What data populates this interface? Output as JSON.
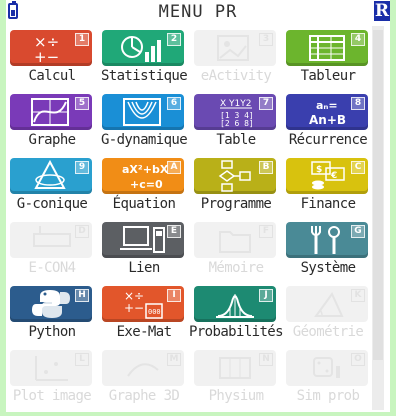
{
  "header": {
    "title": "MENU PR",
    "mode_badge": "R",
    "battery_icon": "battery-icon"
  },
  "colors": {
    "calcul": "#d94a2f",
    "statistique": "#20a878",
    "tableur": "#6cb52d",
    "graphe": "#7a3ab8",
    "gdynamique": "#1a8fd6",
    "table": "#6a4ab2",
    "recurrence": "#3a3fae",
    "gconique": "#2aa0cf",
    "equation": "#f18d16",
    "programme": "#b9b018",
    "finance": "#d8c20e",
    "lien": "#5c5f63",
    "systeme": "#4a8a96",
    "python": "#2c5c8d",
    "exemat": "#e2562b",
    "probabilites": "#1d8a72"
  },
  "apps": [
    {
      "label": "Calcul",
      "key": "1"
    },
    {
      "label": "Statistique",
      "key": "2"
    },
    {
      "label": "eActivity",
      "key": "3"
    },
    {
      "label": "Tableur",
      "key": "4"
    },
    {
      "label": "Graphe",
      "key": "5"
    },
    {
      "label": "G-dynamique",
      "key": "6"
    },
    {
      "label": "Table",
      "key": "7",
      "glyph_text": "X Y1Y2"
    },
    {
      "label": "Récurrence",
      "key": "8",
      "glyph_line1": "aₙ=",
      "glyph_line2": "An+B"
    },
    {
      "label": "G-conique",
      "key": "9"
    },
    {
      "label": "Équation",
      "key": "A",
      "glyph_line1": "aX²+bX",
      "glyph_line2": "+c=0"
    },
    {
      "label": "Programme",
      "key": "B"
    },
    {
      "label": "Finance",
      "key": "C"
    },
    {
      "label": "E-CON4",
      "key": "D"
    },
    {
      "label": "Lien",
      "key": "E"
    },
    {
      "label": "Mémoire",
      "key": "F"
    },
    {
      "label": "Système",
      "key": "G"
    },
    {
      "label": "Python",
      "key": "H"
    },
    {
      "label": "Exe-Mat",
      "key": "I"
    },
    {
      "label": "Probabilités",
      "key": "J"
    },
    {
      "label": "Géométrie",
      "key": "K"
    },
    {
      "label": "Plot image",
      "key": "L"
    },
    {
      "label": "Graphe 3D",
      "key": "M"
    },
    {
      "label": "Physium",
      "key": "N"
    },
    {
      "label": "Sim prob",
      "key": "O"
    }
  ]
}
